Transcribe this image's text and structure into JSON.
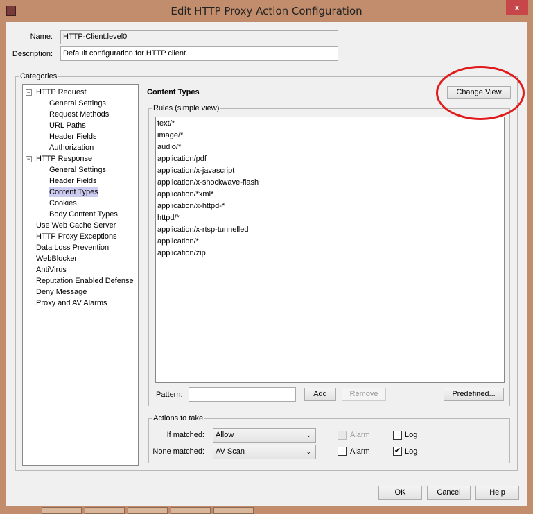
{
  "window": {
    "title": "Edit HTTP Proxy Action Configuration",
    "close_label": "x"
  },
  "form": {
    "name_label": "Name:",
    "name_value": "HTTP-Client.level0",
    "description_label": "Description:",
    "description_value": "Default configuration for HTTP client"
  },
  "categories": {
    "label": "Categories",
    "tree": [
      {
        "label": "HTTP Request",
        "level": 0,
        "expander": true
      },
      {
        "label": "General Settings",
        "level": 1
      },
      {
        "label": "Request Methods",
        "level": 1
      },
      {
        "label": "URL Paths",
        "level": 1
      },
      {
        "label": "Header Fields",
        "level": 1
      },
      {
        "label": "Authorization",
        "level": 1
      },
      {
        "label": "HTTP Response",
        "level": 0,
        "expander": true
      },
      {
        "label": "General Settings",
        "level": 1
      },
      {
        "label": "Header Fields",
        "level": 1
      },
      {
        "label": "Content Types",
        "level": 1,
        "selected": true
      },
      {
        "label": "Cookies",
        "level": 1
      },
      {
        "label": "Body Content Types",
        "level": 1
      },
      {
        "label": "Use Web Cache Server",
        "level": 0
      },
      {
        "label": "HTTP Proxy Exceptions",
        "level": 0
      },
      {
        "label": "Data Loss Prevention",
        "level": 0
      },
      {
        "label": "WebBlocker",
        "level": 0
      },
      {
        "label": "AntiVirus",
        "level": 0
      },
      {
        "label": "Reputation Enabled Defense",
        "level": 0
      },
      {
        "label": "Deny Message",
        "level": 0
      },
      {
        "label": "Proxy and AV Alarms",
        "level": 0
      }
    ]
  },
  "content": {
    "heading": "Content Types",
    "change_view_label": "Change View",
    "rules_label": "Rules (simple view)",
    "rules": [
      "text/*",
      "image/*",
      "audio/*",
      "application/pdf",
      "application/x-javascript",
      "application/x-shockwave-flash",
      "application/*xml*",
      "application/x-httpd-*",
      "httpd/*",
      "application/x-rtsp-tunnelled",
      "application/*",
      "application/zip"
    ],
    "pattern_label": "Pattern:",
    "pattern_value": "",
    "add_label": "Add",
    "remove_label": "Remove",
    "predefined_label": "Predefined..."
  },
  "actions": {
    "label": "Actions to take",
    "if_matched": {
      "label": "If matched:",
      "value": "Allow",
      "alarm_label": "Alarm",
      "alarm_checked": false,
      "alarm_disabled": true,
      "log_label": "Log",
      "log_checked": false
    },
    "none_matched": {
      "label": "None matched:",
      "value": "AV Scan",
      "alarm_label": "Alarm",
      "alarm_checked": false,
      "log_label": "Log",
      "log_checked": true
    }
  },
  "footer": {
    "ok_label": "OK",
    "cancel_label": "Cancel",
    "help_label": "Help"
  },
  "annotation_color": "#e01b1b"
}
